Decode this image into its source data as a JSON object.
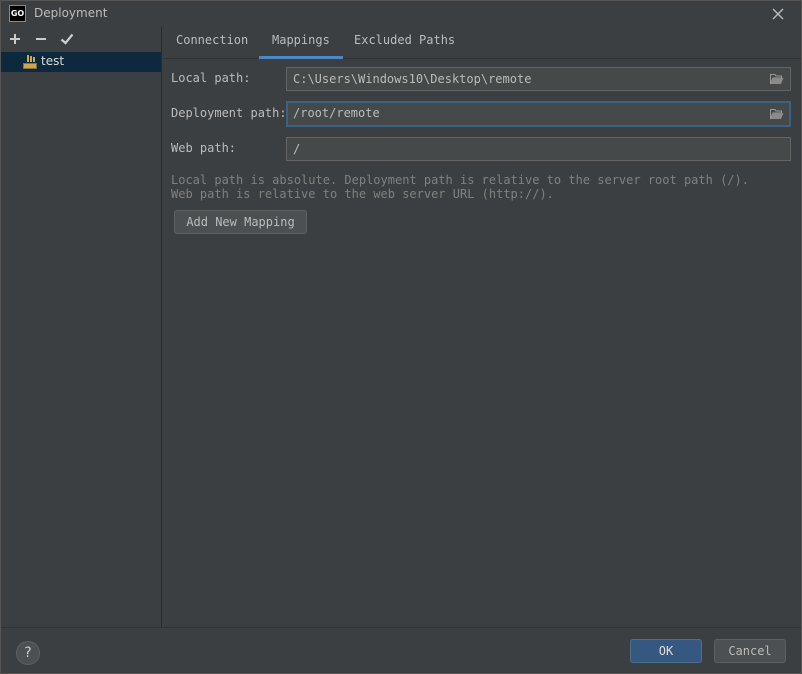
{
  "window": {
    "title": "Deployment",
    "app_icon_text": "GO"
  },
  "sidebar": {
    "toolbar": {
      "add": "+",
      "remove": "−",
      "apply": "✓"
    },
    "items": [
      {
        "label": "test",
        "icon": "sftp-server-icon"
      }
    ]
  },
  "tabs": [
    {
      "label": "Connection",
      "active": false
    },
    {
      "label": "Mappings",
      "active": true
    },
    {
      "label": "Excluded Paths",
      "active": false
    }
  ],
  "mappings": {
    "local_path_label": "Local path:",
    "local_path_value": "C:\\Users\\Windows10\\Desktop\\remote",
    "deployment_path_label": "Deployment path:",
    "deployment_path_value": "/root/remote",
    "web_path_label": "Web path:",
    "web_path_value": "/",
    "help_line1": "Local path is absolute. Deployment path is relative to the server root path (/).",
    "help_line2": "Web path is relative to the web server URL (http://).",
    "add_mapping_label": "Add New Mapping"
  },
  "footer": {
    "help": "?",
    "ok": "OK",
    "cancel": "Cancel"
  },
  "colors": {
    "accent": "#4a88c7",
    "primary_button": "#365880",
    "selection": "#0d293e",
    "background": "#3c3f41"
  }
}
